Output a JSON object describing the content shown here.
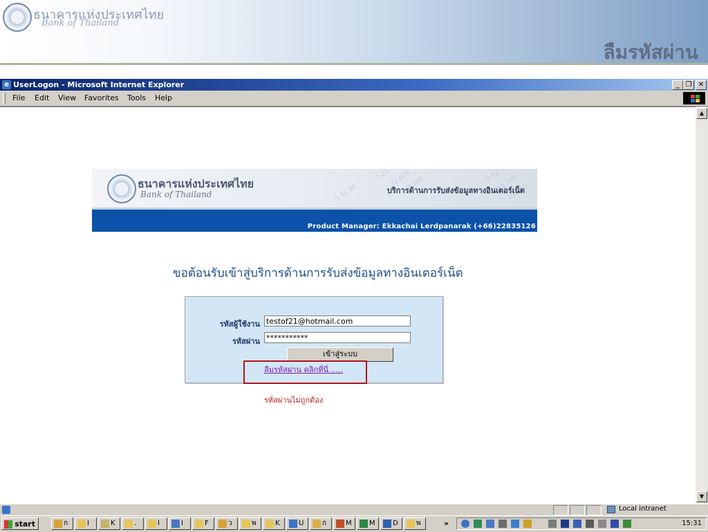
{
  "slide": {
    "logo_th": "ธนาคารแห่งประเทศไทย",
    "logo_en": "Bank of Thailand",
    "title": "ลืมรหัสผ่าน"
  },
  "window": {
    "title": "UserLogon - Microsoft Internet Explorer",
    "controls": [
      "_",
      "❐",
      "✕"
    ],
    "menu": [
      "File",
      "Edit",
      "View",
      "Favorites",
      "Tools",
      "Help"
    ]
  },
  "banner": {
    "logo_th": "ธนาคารแห่งประเทศไทย",
    "logo_en": "Bank of Thailand",
    "service_title": "บริการด้านการรับส่งข้อมูลทางอินเตอร์เน็ต",
    "product_manager": "Product Manager: Ekkachai Lerdpanarak (+66)22835126"
  },
  "page": {
    "welcome": "ขอต้อนรับเข้าสู่บริการด้านการรับส่งข้อมูลทางอินเตอร์เน็ต",
    "username_label": "รหัสผู้ใช้งาน",
    "username_value": "testof21@hotmail.com",
    "password_label": "รหัสผ่าน",
    "password_value": "***********",
    "login_button": "เข้าสู่ระบบ",
    "forgot_link": "ลืมรหัสผ่าน คลิกที่นี่ .....",
    "error_message": "รหัสผ่านไม่ถูกต้อง"
  },
  "statusbar": {
    "zone": "Local intranet"
  },
  "taskbar": {
    "start": "start",
    "tasks": [
      "ก",
      "I",
      "K",
      ".",
      "I",
      "I",
      "F",
      "ว",
      "พ",
      "K",
      "U",
      "ก",
      "M",
      "M",
      "D",
      "พ"
    ],
    "overflow": "»",
    "clock": "15:31"
  },
  "colors": {
    "banner_blue": "#0b52a8",
    "panel_bg": "#d3e6f6",
    "highlight": "#b3121b",
    "error": "#c21c1c",
    "link": "#7a19a8"
  }
}
